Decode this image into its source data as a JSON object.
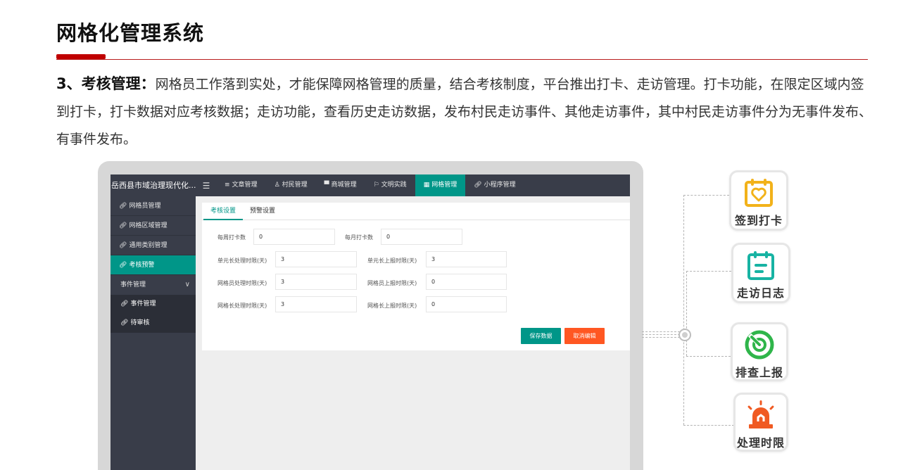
{
  "header": {
    "title": "网格化管理系统",
    "accent_color": "#c00000"
  },
  "intro": {
    "lead": "3、考核管理：",
    "text": "网格员工作落到实处，才能保障网格管理的质量，结合考核制度，平台推出打卡、走访管理。打卡功能，在限定区域内签到打卡，打卡数据对应考核数据；走访功能，查看历史走访数据，发布村民走访事件、其他走访事件，其中村民走访事件分为无事件发布、有事件发布。"
  },
  "app": {
    "name": "岳西县市域治理现代化...",
    "menu_icon": "☰",
    "nav": [
      {
        "label": "文章管理",
        "icon": "list-icon"
      },
      {
        "label": "村民管理",
        "icon": "user-icon"
      },
      {
        "label": "商城管理",
        "icon": "shop-icon"
      },
      {
        "label": "文明实践",
        "icon": "flag-icon"
      },
      {
        "label": "网格管理",
        "icon": "grid-icon",
        "active": true
      },
      {
        "label": "小程序管理",
        "icon": "link-icon"
      }
    ],
    "sidebar": {
      "items": [
        {
          "label": "网格员管理"
        },
        {
          "label": "网格区域管理"
        },
        {
          "label": "通用类别管理"
        },
        {
          "label": "考核预警",
          "active": true
        }
      ],
      "group": {
        "label": "事件管理",
        "chevron": "∨"
      },
      "sub_items": [
        {
          "label": "事件管理"
        },
        {
          "label": "待审核"
        }
      ]
    },
    "tabs": [
      {
        "label": "考核设置",
        "active": true
      },
      {
        "label": "预警设置"
      }
    ],
    "form": {
      "weekly_label": "每周打卡数",
      "weekly_value": "0",
      "monthly_label": "每月打卡数",
      "monthly_value": "0",
      "unit_handle_label": "单元长处理时限(天)",
      "unit_handle_value": "3",
      "unit_report_label": "单元长上报时限(天)",
      "unit_report_value": "3",
      "grid_staff_handle_label": "网格员处理时限(天)",
      "grid_staff_handle_value": "3",
      "grid_staff_report_label": "网格员上报时限(天)",
      "grid_staff_report_value": "0",
      "grid_leader_handle_label": "网格长处理时限(天)",
      "grid_leader_handle_value": "3",
      "grid_leader_report_label": "网格长上报时限(天)",
      "grid_leader_report_value": "0"
    },
    "buttons": {
      "save": "保存数据",
      "cancel": "取消编辑"
    },
    "colors": {
      "primary": "#009688",
      "danger": "#ff5722",
      "dark": "#393d49"
    }
  },
  "features": [
    {
      "label": "签到打卡",
      "icon": "calendar-heart-icon",
      "color": "#f2b21a"
    },
    {
      "label": "走访日志",
      "icon": "clipboard-icon",
      "color": "#17b3a3"
    },
    {
      "label": "排查上报",
      "icon": "target-icon",
      "color": "#2fb54a"
    },
    {
      "label": "处理时限",
      "icon": "alarm-light-icon",
      "color": "#f05a22"
    }
  ]
}
